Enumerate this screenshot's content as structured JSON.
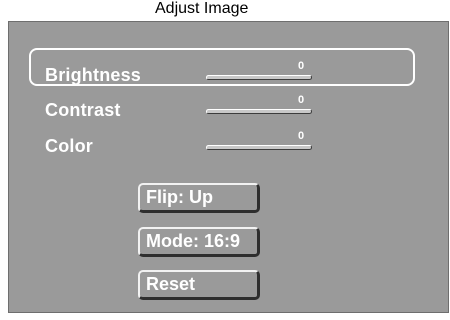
{
  "title": "Adjust Image",
  "items": [
    {
      "label": "Brightness",
      "value": "0"
    },
    {
      "label": "Contrast",
      "value": "0"
    },
    {
      "label": "Color",
      "value": "0"
    }
  ],
  "buttons": {
    "flip": "Flip: Up",
    "mode": "Mode: 16:9",
    "reset": "Reset"
  },
  "colors": {
    "panel": "#9a9a9a",
    "text": "#ffffff",
    "highlight_frame": "#ffffff"
  }
}
